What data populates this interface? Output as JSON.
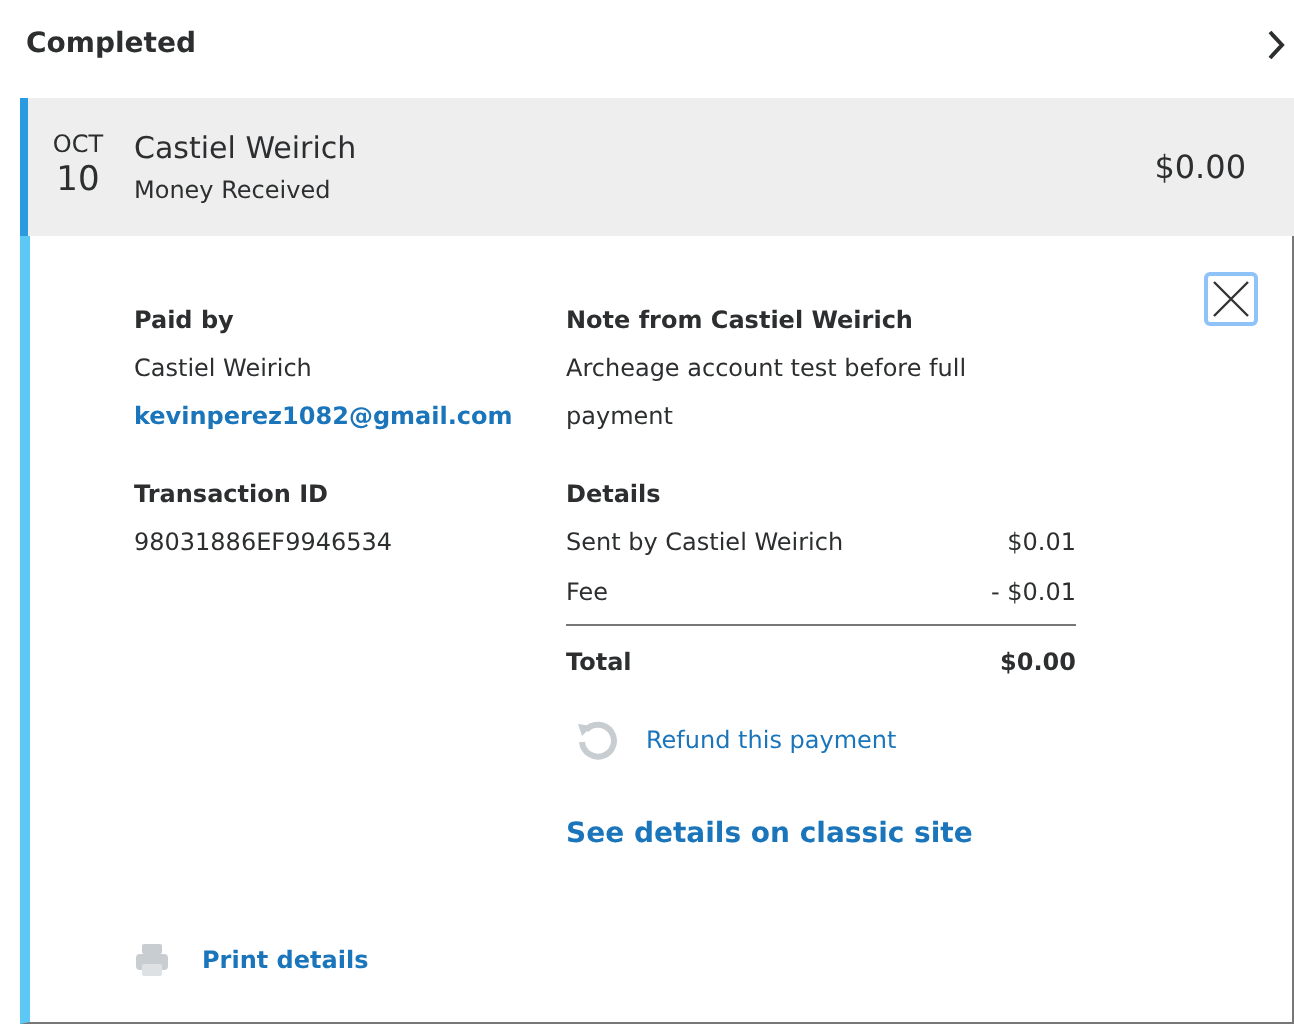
{
  "section": {
    "title": "Completed"
  },
  "transaction": {
    "month": "OCT",
    "day": "10",
    "name": "Castiel Weirich",
    "type": "Money Received",
    "amount": "$0.00",
    "expanded": true
  },
  "paid_by": {
    "heading": "Paid by",
    "name": "Castiel Weirich",
    "email": "kevinperez1082@gmail.com"
  },
  "transaction_id": {
    "heading": "Transaction ID",
    "value": "98031886EF9946534"
  },
  "note": {
    "heading": "Note from Castiel Weirich",
    "text": "Archeage account test before full payment"
  },
  "details": {
    "heading": "Details",
    "lines": [
      {
        "label": "Sent by Castiel Weirich",
        "amount": "$0.01"
      },
      {
        "label": "Fee",
        "amount": "- $0.01"
      }
    ],
    "total": {
      "label": "Total",
      "amount": "$0.00"
    }
  },
  "refund": {
    "label": "Refund this payment"
  },
  "classic_link": {
    "label": "See details on classic site"
  },
  "print": {
    "label": "Print details"
  }
}
